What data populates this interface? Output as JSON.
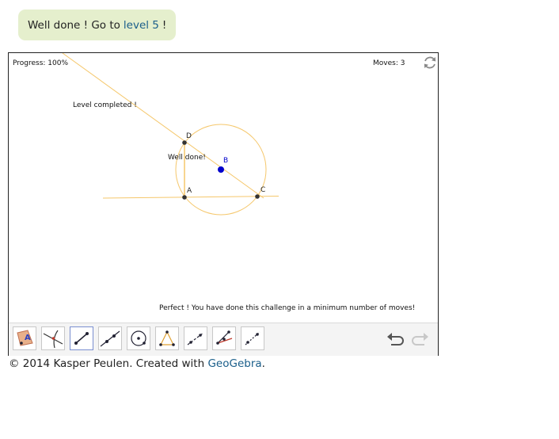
{
  "banner": {
    "prefix": "Well done ! Go to",
    "link": "level 5",
    "suffix": "!"
  },
  "applet": {
    "progress": "Progress: 100%",
    "moves": "Moves: 3",
    "level_completed": "Level completed !",
    "well_done": "Well done!",
    "perfect_message": "Perfect ! You have done this challenge in a minimum number of moves!",
    "points": {
      "D": "D",
      "B": "B",
      "A": "A",
      "C": "C"
    },
    "colors": {
      "construction": "#f5c76b",
      "point": "#333333",
      "center": "#0000cc",
      "selected_tool_border": "#7a8fd0"
    }
  },
  "toolbar": {
    "tools": [
      "move-tool-icon",
      "intersect-tool-icon",
      "segment-tool-icon",
      "line-tool-icon",
      "circle-tool-icon",
      "triangle-tool-icon",
      "parallel-tool-icon",
      "angle-bisector-tool-icon",
      "perpendicular-bisector-tool-icon"
    ],
    "undo_icon": "undo-icon",
    "redo_icon": "redo-icon"
  },
  "footer": {
    "prefix": "© 2014 Kasper Peulen. Created with",
    "link": "GeoGebra",
    "suffix": "."
  }
}
